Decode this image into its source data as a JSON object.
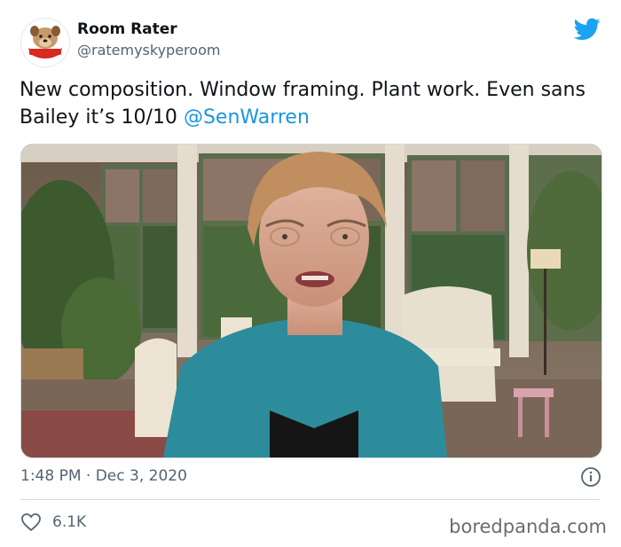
{
  "header": {
    "display_name": "Room Rater",
    "handle": "@ratemyskyperoom",
    "avatar_icon": "room-rater-logo",
    "platform_icon": "twitter-bird-icon"
  },
  "tweet": {
    "text_before": "New composition. Window framing. Plant work. Even sans Bailey it’s 10/10 ",
    "mention": "@SenWarren"
  },
  "media": {
    "description_icon": "video-still"
  },
  "meta": {
    "timestamp": "1:48 PM · Dec 3, 2020",
    "likes": "6.1K"
  },
  "watermark": "boredpanda.com",
  "colors": {
    "accent": "#1da1f2",
    "mention": "#1b95e0",
    "muted": "#536471"
  }
}
